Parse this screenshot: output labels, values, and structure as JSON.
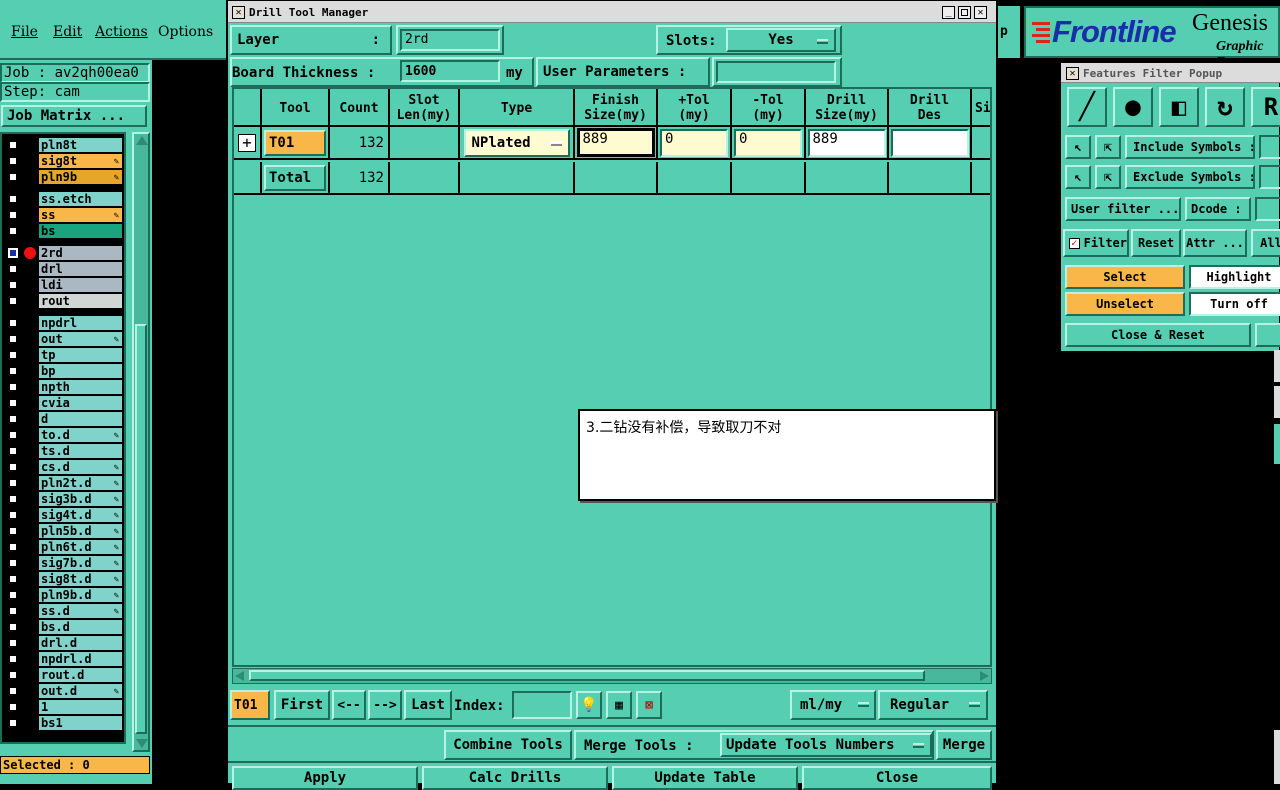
{
  "menubar": {
    "file": "File",
    "edit": "Edit",
    "actions": "Actions",
    "options": "Options"
  },
  "left": {
    "job_label": "Job : av2qh00ea0",
    "step_label": "Step: cam",
    "job_matrix": "Job Matrix ...",
    "selected": "Selected : 0",
    "layers": [
      {
        "name": "pln8t",
        "color": "#7fd3ca"
      },
      {
        "name": "sig8t",
        "color": "#f9b74a",
        "mark": true
      },
      {
        "name": "pln9b",
        "color": "#e6a62a",
        "mark": true
      },
      {
        "name": "ss.etch",
        "color": "#7fd3ca"
      },
      {
        "name": "ss",
        "color": "#f9b74a",
        "mark": true
      },
      {
        "name": "bs",
        "color": "#1aa37f"
      },
      {
        "name": "2rd",
        "color": "#aab8c4",
        "active": true
      },
      {
        "name": "drl",
        "color": "#aab8c4"
      },
      {
        "name": "ldi",
        "color": "#aab8c4"
      },
      {
        "name": "rout",
        "color": "#d0d6d4"
      },
      {
        "name": "npdrl",
        "color": "#7fd3ca"
      },
      {
        "name": "out",
        "color": "#7fd3ca",
        "mark": true
      },
      {
        "name": "tp",
        "color": "#7fd3ca"
      },
      {
        "name": "bp",
        "color": "#7fd3ca"
      },
      {
        "name": "npth",
        "color": "#7fd3ca"
      },
      {
        "name": "cvia",
        "color": "#7fd3ca"
      },
      {
        "name": "d",
        "color": "#7fd3ca"
      },
      {
        "name": "to.d",
        "color": "#7fd3ca",
        "mark": true
      },
      {
        "name": "ts.d",
        "color": "#7fd3ca"
      },
      {
        "name": "cs.d",
        "color": "#7fd3ca",
        "mark": true
      },
      {
        "name": "pln2t.d",
        "color": "#7fd3ca",
        "mark": true
      },
      {
        "name": "sig3b.d",
        "color": "#7fd3ca",
        "mark": true
      },
      {
        "name": "sig4t.d",
        "color": "#7fd3ca",
        "mark": true
      },
      {
        "name": "pln5b.d",
        "color": "#7fd3ca",
        "mark": true
      },
      {
        "name": "pln6t.d",
        "color": "#7fd3ca",
        "mark": true
      },
      {
        "name": "sig7b.d",
        "color": "#7fd3ca",
        "mark": true
      },
      {
        "name": "sig8t.d",
        "color": "#7fd3ca",
        "mark": true
      },
      {
        "name": "pln9b.d",
        "color": "#7fd3ca",
        "mark": true
      },
      {
        "name": "ss.d",
        "color": "#7fd3ca",
        "mark": true
      },
      {
        "name": "bs.d",
        "color": "#7fd3ca"
      },
      {
        "name": "drl.d",
        "color": "#7fd3ca"
      },
      {
        "name": "npdrl.d",
        "color": "#7fd3ca"
      },
      {
        "name": "rout.d",
        "color": "#7fd3ca"
      },
      {
        "name": "out.d",
        "color": "#7fd3ca",
        "mark": true
      },
      {
        "name": "1",
        "color": "#7fd3ca"
      },
      {
        "name": "bs1",
        "color": "#7fd3ca"
      }
    ]
  },
  "dtm": {
    "title": "Drill Tool Manager",
    "layer_label": "Layer",
    "layer_colon": ":",
    "layer_value": "2rd",
    "slots_label": "Slots:",
    "slots_value": "Yes",
    "thickness_label": "Board Thickness :",
    "thickness_value": "1600",
    "thickness_unit": "my",
    "user_params": "User Parameters :",
    "user_params_value": "",
    "columns": [
      "Tool",
      "Count",
      "Slot\nLen(my)",
      "Type",
      "Finish\nSize(my)",
      "+Tol\n(my)",
      "-Tol\n(my)",
      "Drill\nSize(my)",
      "Drill\nDes",
      "Si"
    ],
    "row": {
      "tool": "T01",
      "count": "132",
      "type": "NPlated",
      "finish": "889",
      "ptol": "0",
      "mtol": "0",
      "drill": "889",
      "des": ""
    },
    "total": {
      "label": "Total",
      "count": "132"
    },
    "note": "3.二钻没有补偿，导致取刀不对",
    "nav": {
      "current": "T01",
      "first": "First",
      "prev": "<--",
      "next": "-->",
      "last": "Last",
      "index_label": "Index:",
      "index_value": "",
      "units": "ml/my",
      "mode": "Regular"
    },
    "actions": {
      "combine": "Combine Tools",
      "merge_tools": "Merge Tools :",
      "update_numbers": "Update Tools Numbers",
      "merge": "Merge"
    },
    "bottom": {
      "apply": "Apply",
      "calc": "Calc Drills",
      "update": "Update Table",
      "close": "Close"
    }
  },
  "frontline": {
    "logo": "Frontline",
    "genesis": "Genesis",
    "sub": "Graphic Ec",
    "p": "p"
  },
  "ffp": {
    "title": "Features Filter Popup",
    "include": "Include Symbols :",
    "exclude": "Exclude Symbols :",
    "user_filter": "User filter ...",
    "dcode": "Dcode :",
    "filter": "Filter",
    "reset": "Reset",
    "attr": "Attr ...",
    "all": "All",
    "select": "Select",
    "highlight": "Highlight",
    "unselect": "Unselect",
    "turn_off": "Turn off",
    "close_reset": "Close & Reset"
  }
}
